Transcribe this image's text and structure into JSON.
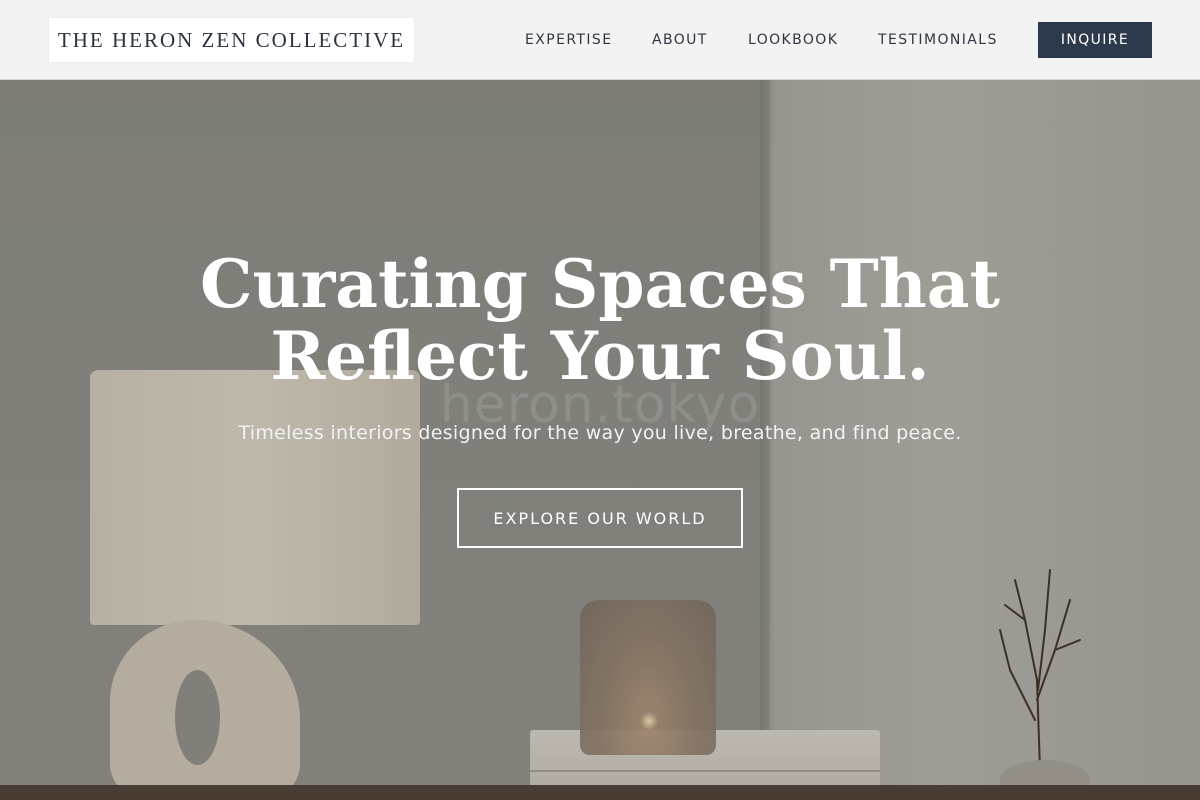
{
  "header": {
    "logo": "THE HERON ZEN COLLECTIVE",
    "nav": [
      "EXPERTISE",
      "ABOUT",
      "LOOKBOOK",
      "TESTIMONIALS"
    ],
    "cta": "INQUIRE"
  },
  "hero": {
    "headline_line1": "Curating Spaces That",
    "headline_line2": "Reflect Your Soul.",
    "subline": "Timeless interiors designed for the way you live, breathe, and find peace.",
    "cta": "EXPLORE OUR WORLD",
    "watermark": "heron.tokyo"
  },
  "colors": {
    "header_bg": "#f8f8f8",
    "primary_button": "#2c3a4b",
    "text_dark": "#2e3643",
    "hero_text": "#ffffff"
  }
}
